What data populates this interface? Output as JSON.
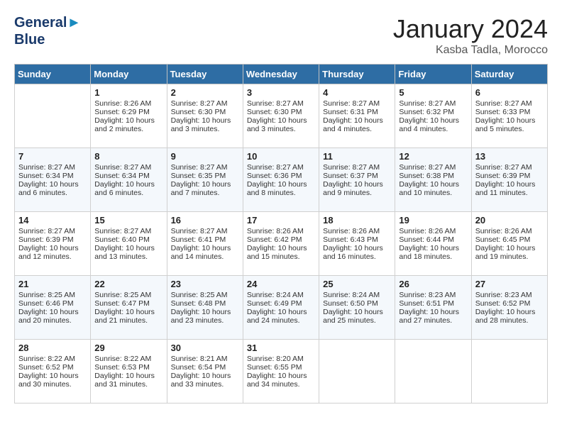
{
  "logo": {
    "line1": "General",
    "line2": "Blue"
  },
  "title": "January 2024",
  "location": "Kasba Tadla, Morocco",
  "days_of_week": [
    "Sunday",
    "Monday",
    "Tuesday",
    "Wednesday",
    "Thursday",
    "Friday",
    "Saturday"
  ],
  "weeks": [
    [
      {
        "day": "",
        "sunrise": "",
        "sunset": "",
        "daylight": ""
      },
      {
        "day": "1",
        "sunrise": "Sunrise: 8:26 AM",
        "sunset": "Sunset: 6:29 PM",
        "daylight": "Daylight: 10 hours and 2 minutes."
      },
      {
        "day": "2",
        "sunrise": "Sunrise: 8:27 AM",
        "sunset": "Sunset: 6:30 PM",
        "daylight": "Daylight: 10 hours and 3 minutes."
      },
      {
        "day": "3",
        "sunrise": "Sunrise: 8:27 AM",
        "sunset": "Sunset: 6:30 PM",
        "daylight": "Daylight: 10 hours and 3 minutes."
      },
      {
        "day": "4",
        "sunrise": "Sunrise: 8:27 AM",
        "sunset": "Sunset: 6:31 PM",
        "daylight": "Daylight: 10 hours and 4 minutes."
      },
      {
        "day": "5",
        "sunrise": "Sunrise: 8:27 AM",
        "sunset": "Sunset: 6:32 PM",
        "daylight": "Daylight: 10 hours and 4 minutes."
      },
      {
        "day": "6",
        "sunrise": "Sunrise: 8:27 AM",
        "sunset": "Sunset: 6:33 PM",
        "daylight": "Daylight: 10 hours and 5 minutes."
      }
    ],
    [
      {
        "day": "7",
        "sunrise": "Sunrise: 8:27 AM",
        "sunset": "Sunset: 6:34 PM",
        "daylight": "Daylight: 10 hours and 6 minutes."
      },
      {
        "day": "8",
        "sunrise": "Sunrise: 8:27 AM",
        "sunset": "Sunset: 6:34 PM",
        "daylight": "Daylight: 10 hours and 6 minutes."
      },
      {
        "day": "9",
        "sunrise": "Sunrise: 8:27 AM",
        "sunset": "Sunset: 6:35 PM",
        "daylight": "Daylight: 10 hours and 7 minutes."
      },
      {
        "day": "10",
        "sunrise": "Sunrise: 8:27 AM",
        "sunset": "Sunset: 6:36 PM",
        "daylight": "Daylight: 10 hours and 8 minutes."
      },
      {
        "day": "11",
        "sunrise": "Sunrise: 8:27 AM",
        "sunset": "Sunset: 6:37 PM",
        "daylight": "Daylight: 10 hours and 9 minutes."
      },
      {
        "day": "12",
        "sunrise": "Sunrise: 8:27 AM",
        "sunset": "Sunset: 6:38 PM",
        "daylight": "Daylight: 10 hours and 10 minutes."
      },
      {
        "day": "13",
        "sunrise": "Sunrise: 8:27 AM",
        "sunset": "Sunset: 6:39 PM",
        "daylight": "Daylight: 10 hours and 11 minutes."
      }
    ],
    [
      {
        "day": "14",
        "sunrise": "Sunrise: 8:27 AM",
        "sunset": "Sunset: 6:39 PM",
        "daylight": "Daylight: 10 hours and 12 minutes."
      },
      {
        "day": "15",
        "sunrise": "Sunrise: 8:27 AM",
        "sunset": "Sunset: 6:40 PM",
        "daylight": "Daylight: 10 hours and 13 minutes."
      },
      {
        "day": "16",
        "sunrise": "Sunrise: 8:27 AM",
        "sunset": "Sunset: 6:41 PM",
        "daylight": "Daylight: 10 hours and 14 minutes."
      },
      {
        "day": "17",
        "sunrise": "Sunrise: 8:26 AM",
        "sunset": "Sunset: 6:42 PM",
        "daylight": "Daylight: 10 hours and 15 minutes."
      },
      {
        "day": "18",
        "sunrise": "Sunrise: 8:26 AM",
        "sunset": "Sunset: 6:43 PM",
        "daylight": "Daylight: 10 hours and 16 minutes."
      },
      {
        "day": "19",
        "sunrise": "Sunrise: 8:26 AM",
        "sunset": "Sunset: 6:44 PM",
        "daylight": "Daylight: 10 hours and 18 minutes."
      },
      {
        "day": "20",
        "sunrise": "Sunrise: 8:26 AM",
        "sunset": "Sunset: 6:45 PM",
        "daylight": "Daylight: 10 hours and 19 minutes."
      }
    ],
    [
      {
        "day": "21",
        "sunrise": "Sunrise: 8:25 AM",
        "sunset": "Sunset: 6:46 PM",
        "daylight": "Daylight: 10 hours and 20 minutes."
      },
      {
        "day": "22",
        "sunrise": "Sunrise: 8:25 AM",
        "sunset": "Sunset: 6:47 PM",
        "daylight": "Daylight: 10 hours and 21 minutes."
      },
      {
        "day": "23",
        "sunrise": "Sunrise: 8:25 AM",
        "sunset": "Sunset: 6:48 PM",
        "daylight": "Daylight: 10 hours and 23 minutes."
      },
      {
        "day": "24",
        "sunrise": "Sunrise: 8:24 AM",
        "sunset": "Sunset: 6:49 PM",
        "daylight": "Daylight: 10 hours and 24 minutes."
      },
      {
        "day": "25",
        "sunrise": "Sunrise: 8:24 AM",
        "sunset": "Sunset: 6:50 PM",
        "daylight": "Daylight: 10 hours and 25 minutes."
      },
      {
        "day": "26",
        "sunrise": "Sunrise: 8:23 AM",
        "sunset": "Sunset: 6:51 PM",
        "daylight": "Daylight: 10 hours and 27 minutes."
      },
      {
        "day": "27",
        "sunrise": "Sunrise: 8:23 AM",
        "sunset": "Sunset: 6:52 PM",
        "daylight": "Daylight: 10 hours and 28 minutes."
      }
    ],
    [
      {
        "day": "28",
        "sunrise": "Sunrise: 8:22 AM",
        "sunset": "Sunset: 6:52 PM",
        "daylight": "Daylight: 10 hours and 30 minutes."
      },
      {
        "day": "29",
        "sunrise": "Sunrise: 8:22 AM",
        "sunset": "Sunset: 6:53 PM",
        "daylight": "Daylight: 10 hours and 31 minutes."
      },
      {
        "day": "30",
        "sunrise": "Sunrise: 8:21 AM",
        "sunset": "Sunset: 6:54 PM",
        "daylight": "Daylight: 10 hours and 33 minutes."
      },
      {
        "day": "31",
        "sunrise": "Sunrise: 8:20 AM",
        "sunset": "Sunset: 6:55 PM",
        "daylight": "Daylight: 10 hours and 34 minutes."
      },
      {
        "day": "",
        "sunrise": "",
        "sunset": "",
        "daylight": ""
      },
      {
        "day": "",
        "sunrise": "",
        "sunset": "",
        "daylight": ""
      },
      {
        "day": "",
        "sunrise": "",
        "sunset": "",
        "daylight": ""
      }
    ]
  ]
}
